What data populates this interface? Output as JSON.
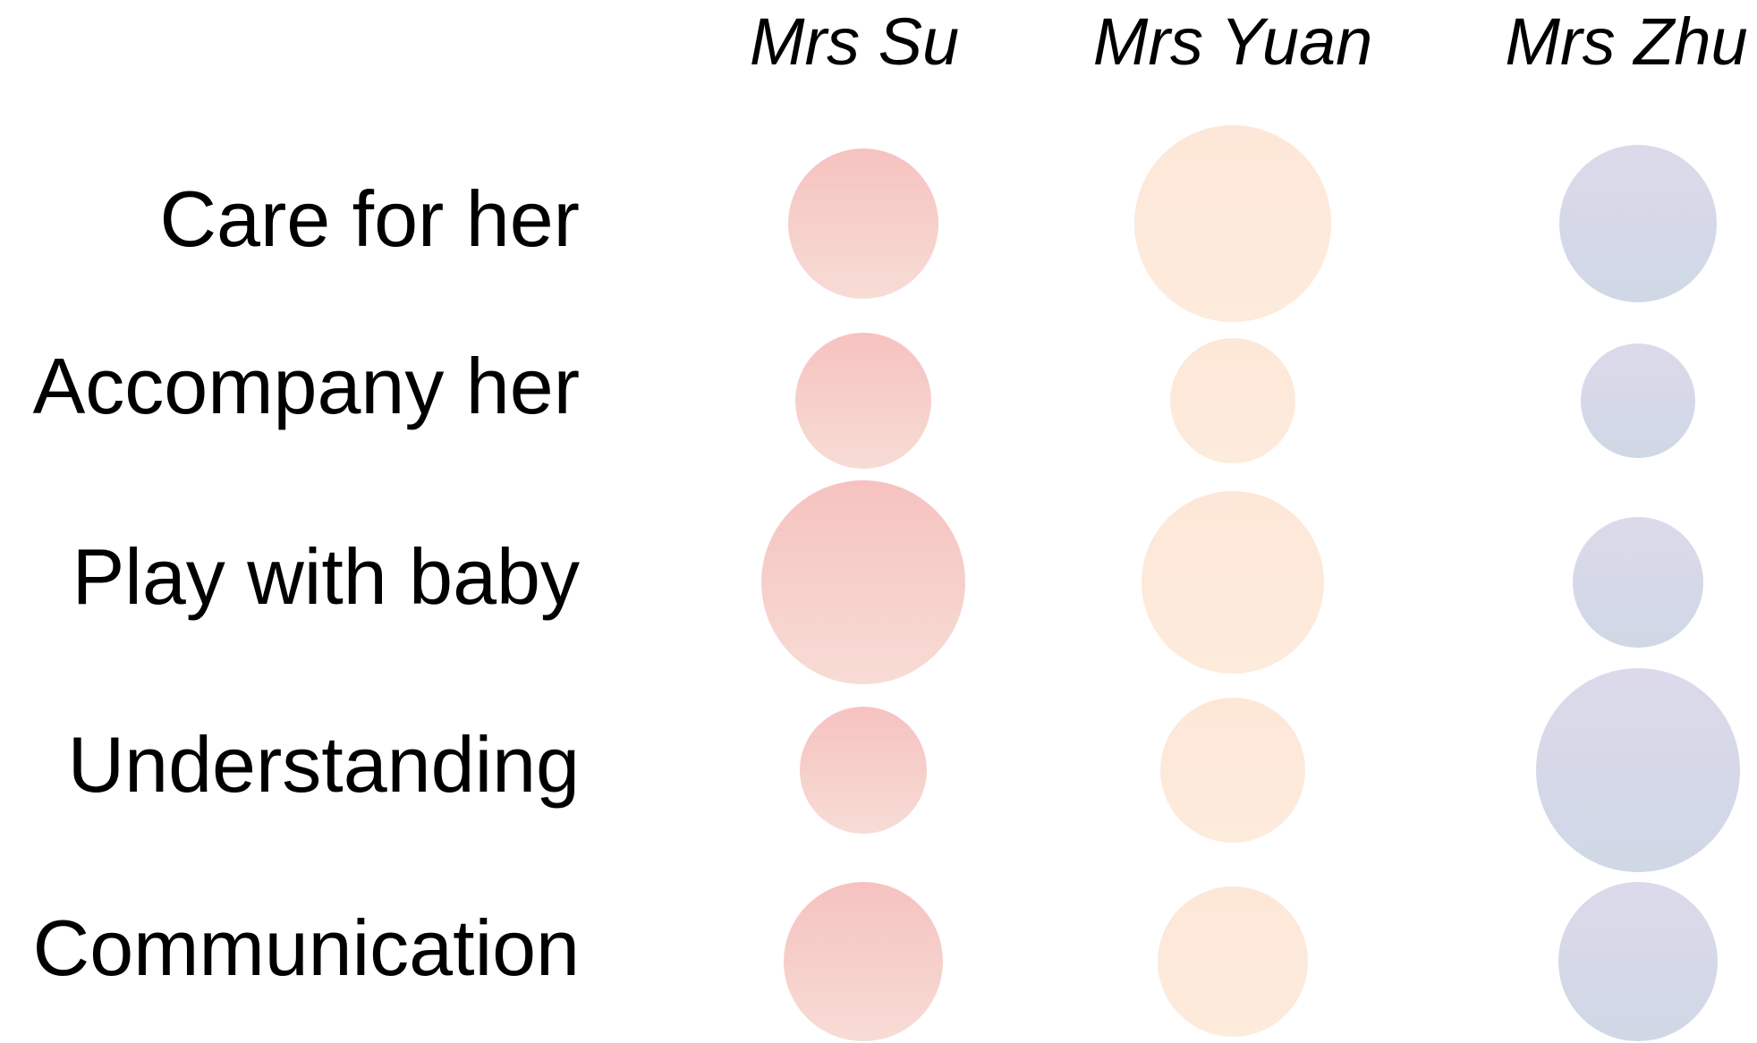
{
  "chart_data": {
    "type": "bubble-matrix",
    "title": "",
    "columns": [
      "Mrs Su",
      "Mrs Yuan",
      "Mrs Zhu"
    ],
    "rows": [
      "Care for her",
      "Accompany her",
      "Play with baby",
      "Understanding",
      "Communication"
    ],
    "column_colors": {
      "Mrs Su": {
        "top": "#f6c2c0",
        "bottom": "#f7dcd5"
      },
      "Mrs Yuan": {
        "top": "#fde7d8",
        "bottom": "#fdebdc"
      },
      "Mrs Zhu": {
        "top": "#dcd9ea",
        "bottom": "#cfd8e6"
      }
    },
    "values": [
      [
        84,
        110,
        88
      ],
      [
        76,
        70,
        64
      ],
      [
        114,
        102,
        73
      ],
      [
        71,
        81,
        114
      ],
      [
        89,
        84,
        89
      ]
    ],
    "value_scale": "relative bubble diameter",
    "legend": "none",
    "grid": false
  }
}
